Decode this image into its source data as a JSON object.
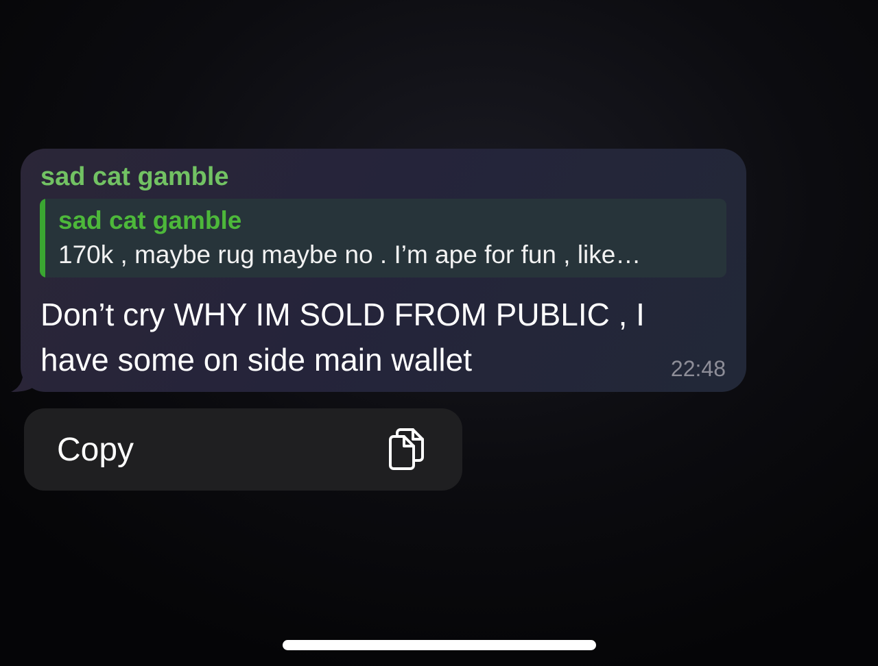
{
  "message": {
    "sender": "sad cat gamble",
    "reply": {
      "sender": "sad cat gamble",
      "text": "170k , maybe rug maybe no . I’m ape for fun , like…"
    },
    "text": "Don’t cry WHY IM SOLD FROM PUBLIC  , I have some on side main wallet",
    "time": "22:48"
  },
  "context_menu": {
    "items": [
      {
        "label": "Copy",
        "icon": "copy-icon"
      }
    ]
  },
  "colors": {
    "sender_name": "#72c263",
    "reply_bar": "#3aa631",
    "reply_sender": "#4db83a",
    "bubble": "#27253a",
    "menu_background": "#1f1f21",
    "timestamp": "#8e8e98"
  }
}
